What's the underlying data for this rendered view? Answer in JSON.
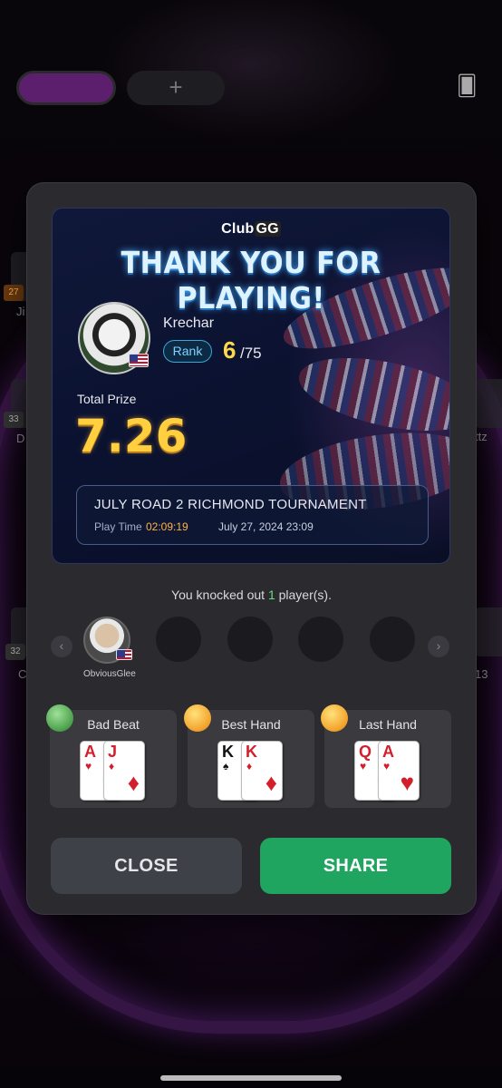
{
  "background": {
    "table_tab_add": "+",
    "seats": [
      {
        "badge": "27",
        "name": "Ji"
      },
      {
        "badge": "33",
        "name": "D"
      },
      {
        "badge": "32",
        "name": "C"
      },
      {
        "badge": "",
        "name": "ttz"
      },
      {
        "badge": "",
        "name": "13"
      }
    ]
  },
  "modal": {
    "logo_club": "Club",
    "logo_gg": "GG",
    "title": "THANK YOU FOR PLAYING!",
    "player": {
      "name": "Krechar",
      "rank_label": "Rank",
      "rank": "6",
      "rank_total": "/75"
    },
    "prize": {
      "label": "Total Prize",
      "value": "7.26"
    },
    "tournament": {
      "name": "JULY ROAD 2 RICHMOND TOURNAMENT",
      "play_time_label": "Play Time",
      "play_time": "02:09:19",
      "date": "July 27, 2024 23:09"
    },
    "knockout": {
      "prefix": "You knocked out ",
      "count": "1",
      "suffix": " player(s).",
      "players": [
        {
          "name": "ObviousGlee"
        }
      ],
      "prev_arrow": "‹",
      "next_arrow": "›"
    },
    "hands": [
      {
        "title": "Bad Beat",
        "cards": [
          {
            "rank": "A",
            "suit": "♥"
          },
          {
            "rank": "J",
            "suit": "♦"
          }
        ]
      },
      {
        "title": "Best Hand",
        "cards": [
          {
            "rank": "K",
            "suit": "♠"
          },
          {
            "rank": "K",
            "suit": "♦"
          }
        ]
      },
      {
        "title": "Last Hand",
        "cards": [
          {
            "rank": "Q",
            "suit": "♥"
          },
          {
            "rank": "A",
            "suit": "♥"
          }
        ]
      }
    ],
    "buttons": {
      "close": "CLOSE",
      "share": "SHARE"
    }
  },
  "colors": {
    "accent_green": "#1fa560",
    "rank_yellow": "#ffd84a",
    "prize_gold": "#ffcf3f",
    "modal_bg": "#2b2b2f"
  }
}
